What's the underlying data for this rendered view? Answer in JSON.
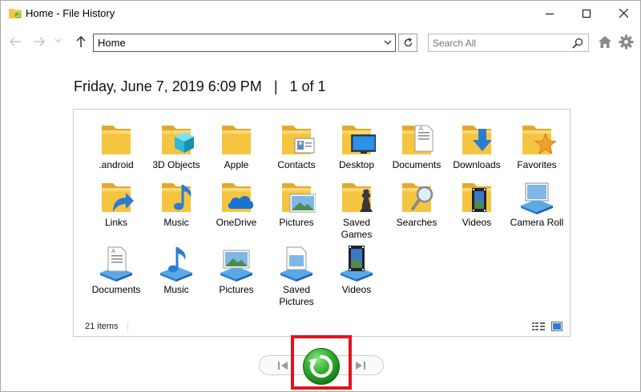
{
  "window": {
    "title": "Home - File History"
  },
  "navbar": {
    "address_value": "Home",
    "search_placeholder": "Search All"
  },
  "header": {
    "date": "Friday, June 7, 2019 6:09 PM",
    "separator": "|",
    "page_indicator": "1 of 1"
  },
  "items": [
    {
      "label": ".android",
      "icon": "folder-icon"
    },
    {
      "label": "3D Objects",
      "icon": "folder-3d-objects-icon"
    },
    {
      "label": "Apple",
      "icon": "folder-icon"
    },
    {
      "label": "Contacts",
      "icon": "folder-contacts-icon"
    },
    {
      "label": "Desktop",
      "icon": "folder-desktop-icon"
    },
    {
      "label": "Documents",
      "icon": "folder-documents-icon"
    },
    {
      "label": "Downloads",
      "icon": "folder-downloads-icon"
    },
    {
      "label": "Favorites",
      "icon": "folder-favorites-icon"
    },
    {
      "label": "Links",
      "icon": "folder-links-icon"
    },
    {
      "label": "Music",
      "icon": "folder-music-icon"
    },
    {
      "label": "OneDrive",
      "icon": "folder-onedrive-icon"
    },
    {
      "label": "Pictures",
      "icon": "folder-pictures-icon"
    },
    {
      "label": "Saved Games",
      "icon": "folder-saved-games-icon"
    },
    {
      "label": "Searches",
      "icon": "folder-searches-icon"
    },
    {
      "label": "Videos",
      "icon": "folder-videos-icon"
    },
    {
      "label": "Camera Roll",
      "icon": "library-camera-roll-icon"
    },
    {
      "label": "Documents",
      "icon": "library-documents-icon"
    },
    {
      "label": "Music",
      "icon": "library-music-icon"
    },
    {
      "label": "Pictures",
      "icon": "library-pictures-icon"
    },
    {
      "label": "Saved Pictures",
      "icon": "library-saved-pictures-icon"
    },
    {
      "label": "Videos",
      "icon": "library-videos-icon"
    }
  ],
  "status": {
    "item_count": "21 items"
  },
  "colors": {
    "folder_yellow": "#f5c542",
    "restore_green": "#2fae2f",
    "highlight_red": "#e0141e",
    "accent_blue": "#2b7cd3"
  }
}
